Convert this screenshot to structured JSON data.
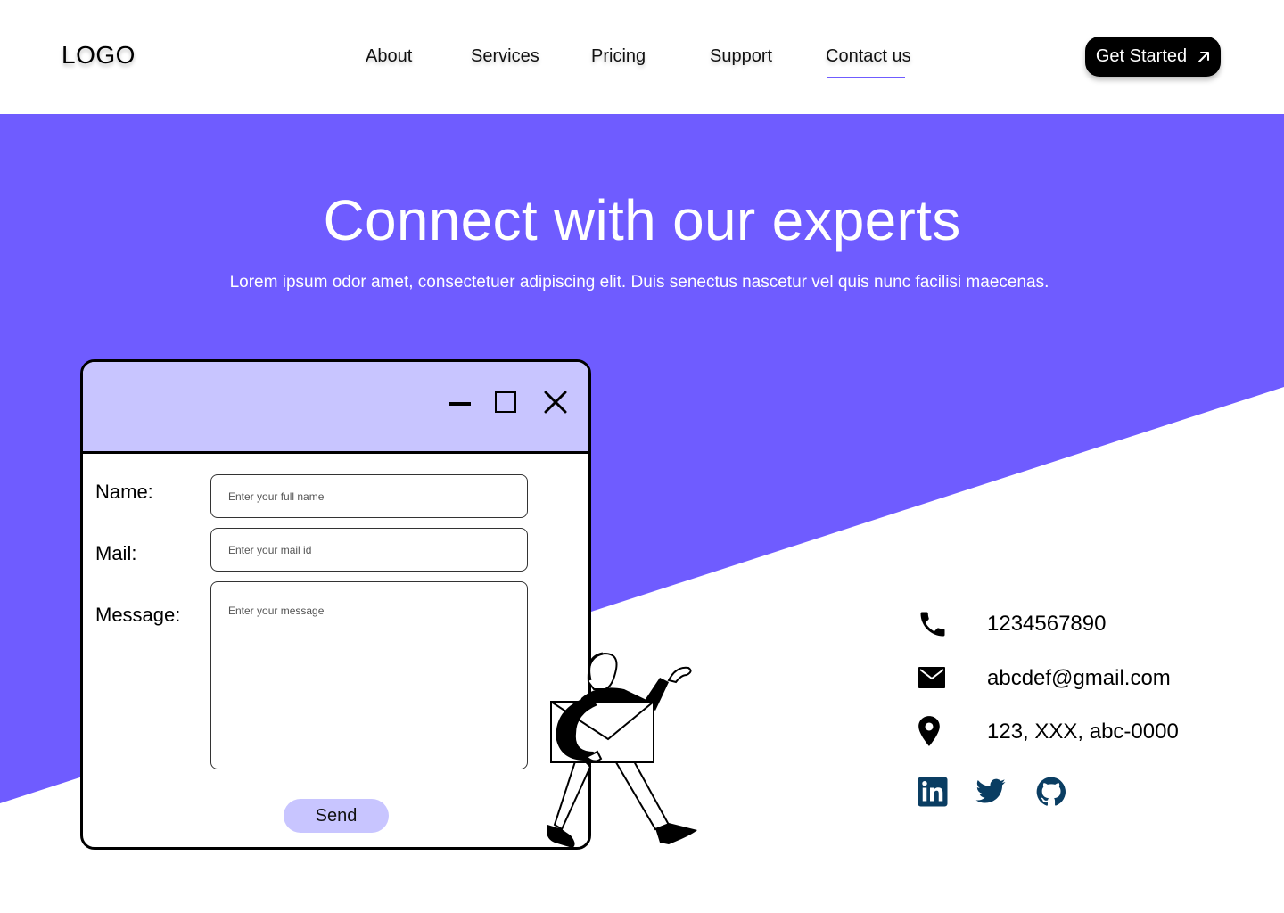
{
  "header": {
    "logo": "LOGO",
    "nav": [
      "About",
      "Services",
      "Pricing",
      "Support",
      "Contact us"
    ],
    "active_nav": "Contact us",
    "cta_label": "Get Started"
  },
  "hero": {
    "title": "Connect with our experts",
    "subtitle": "Lorem ipsum odor amet, consectetuer adipiscing elit. Duis senectus nascetur vel quis nunc facilisi maecenas."
  },
  "form": {
    "name_label": "Name:",
    "name_placeholder": "Enter your full name",
    "mail_label": "Mail:",
    "mail_placeholder": "Enter your mail id",
    "message_label": "Message:",
    "message_placeholder": "Enter your message",
    "send_label": "Send",
    "window_controls": [
      "minimize-icon",
      "maximize-icon",
      "close-icon"
    ]
  },
  "contact": {
    "phone": "1234567890",
    "email": "abcdef@gmail.com",
    "address": "123, XXX, abc-0000",
    "icons": [
      "phone-icon",
      "mail-icon",
      "location-pin-icon"
    ],
    "social": [
      "linkedin-icon",
      "twitter-icon",
      "github-icon"
    ]
  },
  "colors": {
    "accent": "#6f5cff",
    "window_bar": "#c8c5ff",
    "social_icon": "#0a3d62",
    "background": "#ffffff"
  }
}
